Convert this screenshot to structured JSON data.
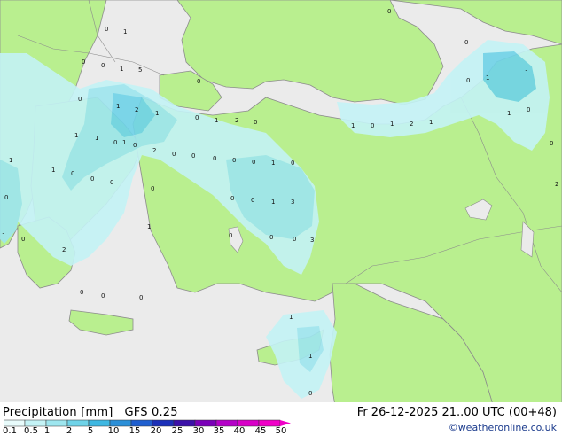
{
  "footer": {
    "product_label": "Precipitation [mm]",
    "model_label": "GFS 0.25",
    "valid_time": "Fr 26-12-2025 21..00 UTC (00+48)",
    "credit": "©weatheronline.co.uk"
  },
  "legend": {
    "ticks": [
      "0.1",
      "0.5",
      "1",
      "2",
      "5",
      "10",
      "15",
      "20",
      "25",
      "30",
      "35",
      "40",
      "45",
      "50"
    ],
    "colors": [
      "#e8fbfb",
      "#c4f3f6",
      "#9ee6ef",
      "#6fd3e8",
      "#3fb8e2",
      "#2b8fd8",
      "#1f5fcf",
      "#1b2fb8",
      "#3b10a8",
      "#7a00b8",
      "#b400c8",
      "#d800c8",
      "#f000c8"
    ]
  },
  "map_colors": {
    "land": "#b9ef8f",
    "sea": "#ebebeb",
    "border": "#8c8c8c"
  },
  "precip_labels": [
    "0",
    "0",
    "1",
    "0",
    "0",
    "0",
    "1",
    "5",
    "1",
    "0",
    "0",
    "1",
    "1",
    "2",
    "0",
    "1",
    "0",
    "1",
    "2",
    "0",
    "1",
    "0",
    "2",
    "1",
    "0",
    "1",
    "1",
    "1",
    "1",
    "0",
    "1",
    "0",
    "2",
    "0",
    "0",
    "0",
    "0",
    "0",
    "1",
    "0",
    "0",
    "1",
    "1",
    "0",
    "0",
    "0",
    "0",
    "2",
    "0",
    "0",
    "0",
    "1",
    "3",
    "1",
    "1",
    "0",
    "0",
    "0",
    "0",
    "3",
    "2",
    "0",
    "0",
    "0",
    "1",
    "1",
    "0"
  ]
}
